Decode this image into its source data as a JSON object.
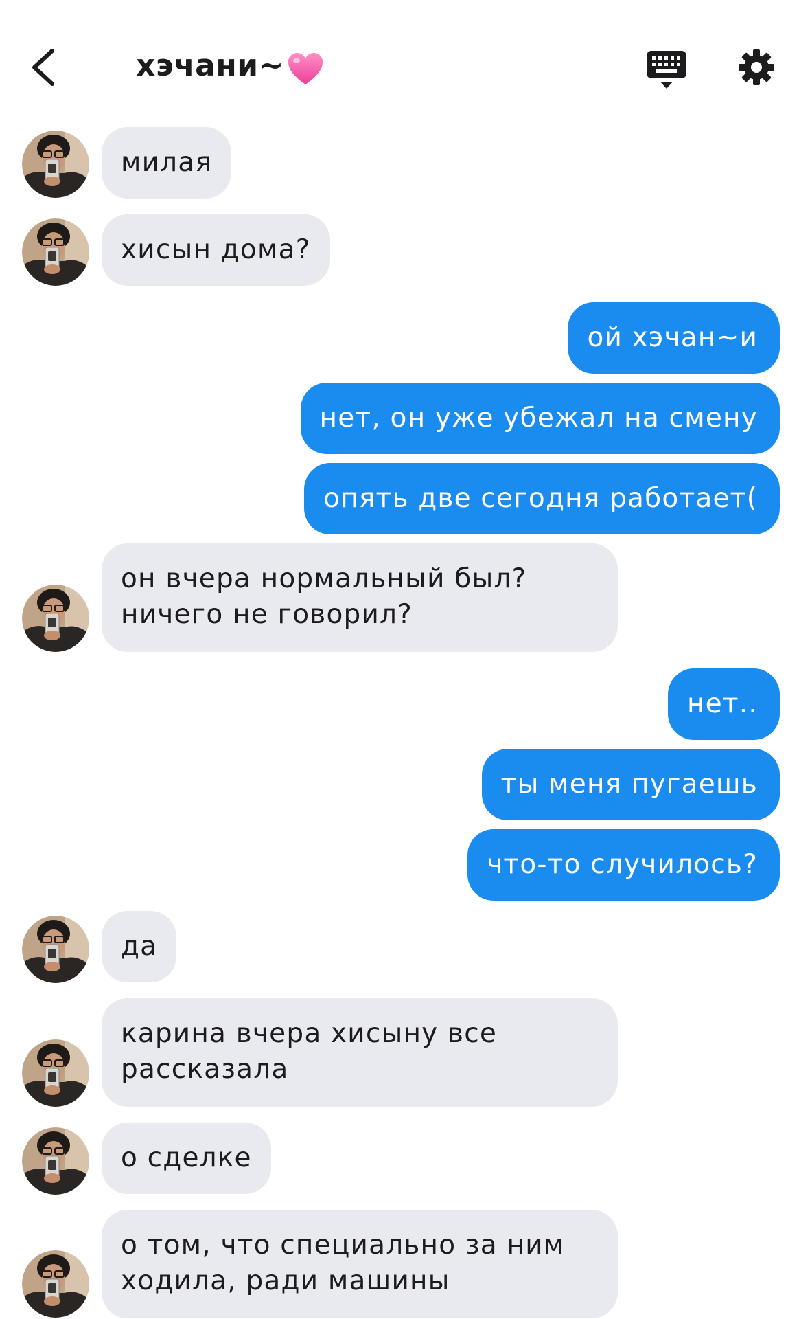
{
  "header": {
    "title": "хэчани~",
    "heart_emoji": "heart-emoji-icon",
    "icons": [
      "back-chevron-icon",
      "keyboard-icon",
      "gear-icon"
    ]
  },
  "colors": {
    "incoming_bubble": "#e9eaf0",
    "outgoing_bubble": "#1a8cf0",
    "outgoing_text": "#ffffff",
    "heart": "#f25aa8"
  },
  "messages": [
    {
      "from": "them",
      "text": "милая"
    },
    {
      "from": "them",
      "text": "хисын дома?"
    },
    {
      "from": "me",
      "text": "ой хэчан~и"
    },
    {
      "from": "me",
      "text": "нет, он уже убежал на смену"
    },
    {
      "from": "me",
      "text": "опять две сегодня работает("
    },
    {
      "from": "them",
      "lines": [
        "он вчера нормальный был?",
        "ничего не говорил?"
      ]
    },
    {
      "from": "me",
      "text": "нет.."
    },
    {
      "from": "me",
      "text": "ты меня пугаешь"
    },
    {
      "from": "me",
      "text": "что-то случилось?"
    },
    {
      "from": "them",
      "text": "да"
    },
    {
      "from": "them",
      "lines": [
        "карина вчера хисыну все",
        "рассказала"
      ]
    },
    {
      "from": "them",
      "text": "о сделке"
    },
    {
      "from": "them",
      "lines": [
        "о том, что специально за ним",
        "ходила, ради машины"
      ]
    }
  ]
}
